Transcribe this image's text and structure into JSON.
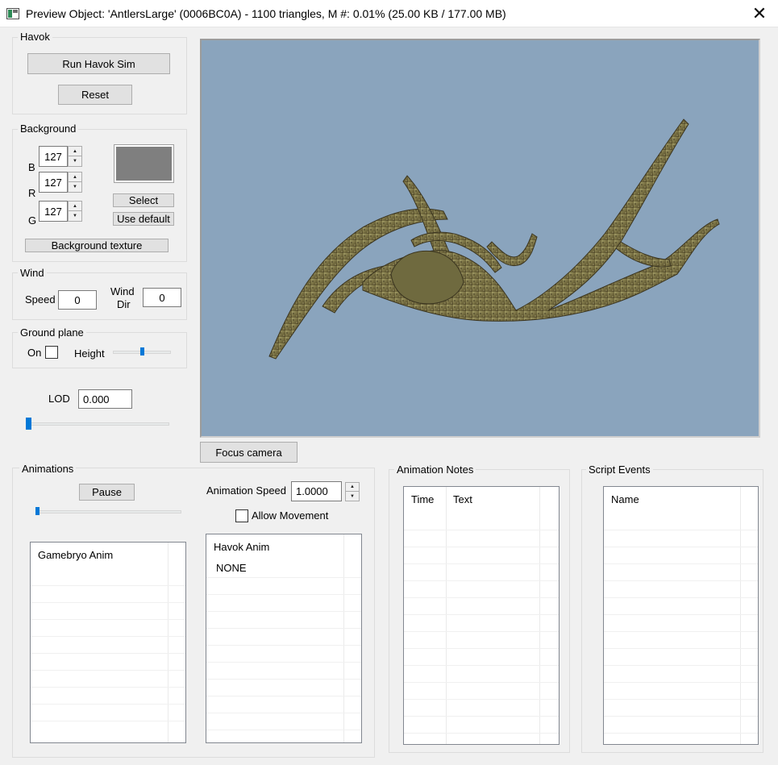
{
  "window": {
    "title": "Preview Object: 'AntlersLarge' (0006BC0A) - 1100 triangles, M #: 0.01% (25.00 KB / 177.00 MB)",
    "close_glyph": "✕"
  },
  "havok": {
    "label": "Havok",
    "run_sim": "Run Havok Sim",
    "reset": "Reset"
  },
  "background": {
    "label": "Background",
    "channels": [
      {
        "name": "B",
        "value": "127"
      },
      {
        "name": "R",
        "value": "127"
      },
      {
        "name": "G",
        "value": "127"
      }
    ],
    "swatch_color": "#7f7f7f",
    "select": "Select",
    "use_default": "Use default",
    "texture": "Background texture"
  },
  "wind": {
    "label": "Wind",
    "speed_label": "Speed",
    "speed": "0",
    "dir_label_1": "Wind",
    "dir_label_2": "Dir",
    "dir": "0"
  },
  "ground_plane": {
    "label": "Ground plane",
    "on_label": "On",
    "on_checked": false,
    "height_label": "Height",
    "height_level": 0.5
  },
  "lod": {
    "label": "LOD",
    "value": "0.000",
    "slider_level": 0
  },
  "viewport": {
    "background_color": "#8aa4bd",
    "object": "antlers-model"
  },
  "focus_camera": "Focus camera",
  "animations": {
    "label": "Animations",
    "pause": "Pause",
    "slider_level": 0,
    "speed_label": "Animation Speed",
    "speed": "1.0000",
    "allow_movement": "Allow Movement",
    "allow_movement_checked": false,
    "gamebryo_header": "Gamebryo Anim",
    "havok_header": "Havok Anim",
    "havok_rows": [
      "NONE"
    ]
  },
  "animation_notes": {
    "label": "Animation Notes",
    "col_time": "Time",
    "col_text": "Text"
  },
  "script_events": {
    "label": "Script Events",
    "col_name": "Name"
  }
}
